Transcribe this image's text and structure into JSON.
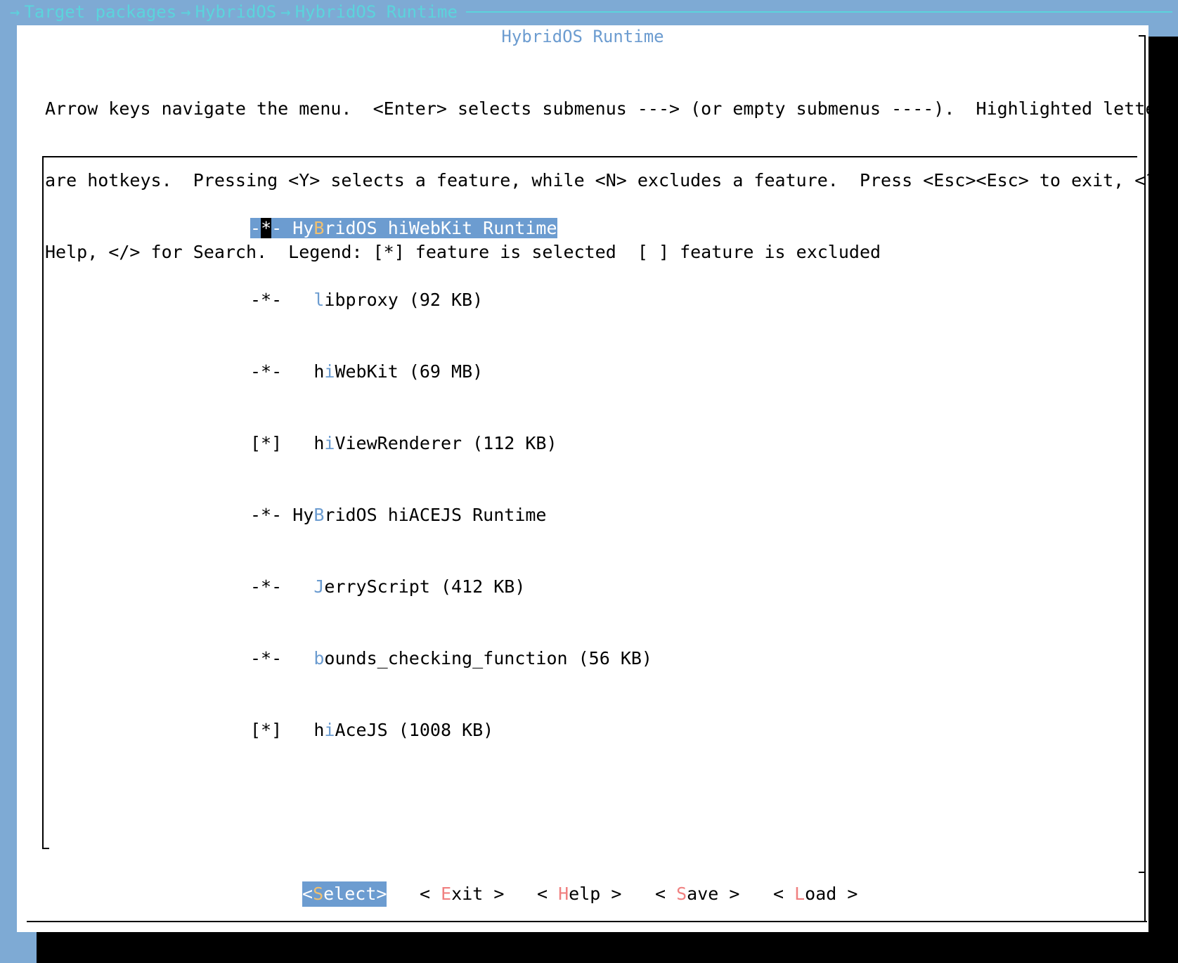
{
  "breadcrumb": {
    "items": [
      "Target packages",
      "HybridOS",
      "HybridOS Runtime"
    ],
    "separator": "→"
  },
  "dialog": {
    "title": "HybridOS Runtime",
    "help_lines": [
      "Arrow keys navigate the menu.  <Enter> selects submenus ---> (or empty submenus ----).  Highlighted letters",
      "are hotkeys.  Pressing <Y> selects a feature, while <N> excludes a feature.  Press <Esc><Esc> to exit, <?> for",
      "Help, </> for Search.  Legend: [*] feature is selected  [ ] feature is excluded"
    ]
  },
  "menu": {
    "items": [
      {
        "marker_a": "-",
        "marker_cursor": "*",
        "marker_b": "- ",
        "indent": "",
        "pre": "Hy",
        "hot": "B",
        "post": "ridOS hiWebKit Runtime",
        "selected": true
      },
      {
        "marker_a": "-*- ",
        "marker_cursor": "",
        "marker_b": "",
        "indent": "  ",
        "pre": "",
        "hot": "l",
        "post": "ibproxy (92 KB)",
        "selected": false
      },
      {
        "marker_a": "-*- ",
        "marker_cursor": "",
        "marker_b": "",
        "indent": "  ",
        "pre": "h",
        "hot": "i",
        "post": "WebKit (69 MB)",
        "selected": false
      },
      {
        "marker_a": "[*] ",
        "marker_cursor": "",
        "marker_b": "",
        "indent": "  ",
        "pre": "h",
        "hot": "i",
        "post": "ViewRenderer (112 KB)",
        "selected": false
      },
      {
        "marker_a": "-*- ",
        "marker_cursor": "",
        "marker_b": "",
        "indent": "",
        "pre": "Hy",
        "hot": "B",
        "post": "ridOS hiACEJS Runtime",
        "selected": false
      },
      {
        "marker_a": "-*- ",
        "marker_cursor": "",
        "marker_b": "",
        "indent": "  ",
        "pre": "",
        "hot": "J",
        "post": "erryScript (412 KB)",
        "selected": false
      },
      {
        "marker_a": "-*- ",
        "marker_cursor": "",
        "marker_b": "",
        "indent": "  ",
        "pre": "",
        "hot": "b",
        "post": "ounds_checking_function (56 KB)",
        "selected": false
      },
      {
        "marker_a": "[*] ",
        "marker_cursor": "",
        "marker_b": "",
        "indent": "  ",
        "pre": "h",
        "hot": "i",
        "post": "AceJS (1008 KB)",
        "selected": false
      }
    ]
  },
  "buttons": {
    "select": {
      "open": "<",
      "hot": "S",
      "rest": "elect",
      "close": ">"
    },
    "exit": {
      "open": "< ",
      "hot": "E",
      "rest": "xit",
      "close": " >"
    },
    "help": {
      "open": "< ",
      "hot": "H",
      "rest": "elp",
      "close": " >"
    },
    "save": {
      "open": "< ",
      "hot": "S",
      "rest": "ave",
      "close": " >"
    },
    "load": {
      "open": "< ",
      "hot": "L",
      "rest": "oad",
      "close": " >"
    }
  },
  "colors": {
    "background": "#7eaad4",
    "accent": "#6c9cd0",
    "breadcrumb": "#5bd4dc",
    "hotkey_button": "#f08080",
    "hotkey_selected": "#f0c070"
  }
}
